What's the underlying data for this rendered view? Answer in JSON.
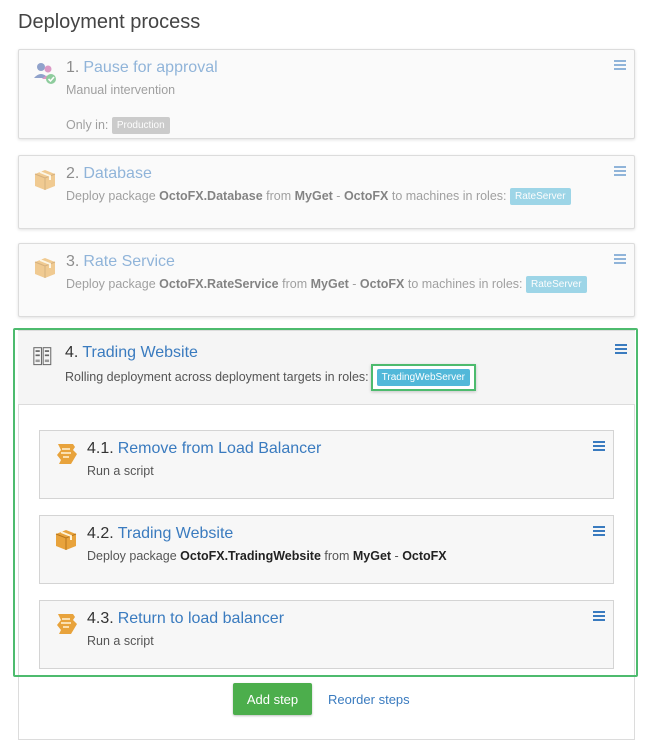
{
  "page": {
    "title": "Deployment process"
  },
  "steps": [
    {
      "number": "1.",
      "name": "Pause for approval",
      "description": "Manual intervention",
      "only_in_label": "Only in:",
      "environment": "Production",
      "icon": "users-approval-icon"
    },
    {
      "number": "2.",
      "name": "Database",
      "desc_prefix": "Deploy package",
      "package": "OctoFX.Database",
      "from_label": "from",
      "feed_a": "MyGet",
      "feed_sep": " - ",
      "feed_b": "OctoFX",
      "roles_label": "to machines in roles:",
      "role": "RateServer",
      "icon": "package-icon"
    },
    {
      "number": "3.",
      "name": "Rate Service",
      "desc_prefix": "Deploy package",
      "package": "OctoFX.RateService",
      "from_label": "from",
      "feed_a": "MyGet",
      "feed_sep": " - ",
      "feed_b": "OctoFX",
      "roles_label": "to machines in roles:",
      "role": "RateServer",
      "icon": "package-icon"
    },
    {
      "number": "4.",
      "name": "Trading Website",
      "description": "Rolling deployment across deployment targets in roles:",
      "role": "TradingWebServer",
      "icon": "rolling-deploy-icon"
    }
  ],
  "children": [
    {
      "number": "4.1.",
      "name": "Remove from Load Balancer",
      "description": "Run a script",
      "icon": "script-icon"
    },
    {
      "number": "4.2.",
      "name": "Trading Website",
      "desc_prefix": "Deploy package",
      "package": "OctoFX.TradingWebsite",
      "from_label": "from",
      "feed_a": "MyGet",
      "feed_sep": " - ",
      "feed_b": "OctoFX",
      "icon": "package-icon"
    },
    {
      "number": "4.3.",
      "name": "Return to load balancer",
      "description": "Run a script",
      "icon": "script-icon"
    }
  ],
  "actions": {
    "add_step": "Add step",
    "reorder_steps": "Reorder steps"
  },
  "colors": {
    "link": "#3a7bbf",
    "highlight": "#4dbb6e",
    "role_badge": "#52b8d9",
    "env_badge": "#a6a6a6",
    "add_button": "#4cae4c"
  }
}
